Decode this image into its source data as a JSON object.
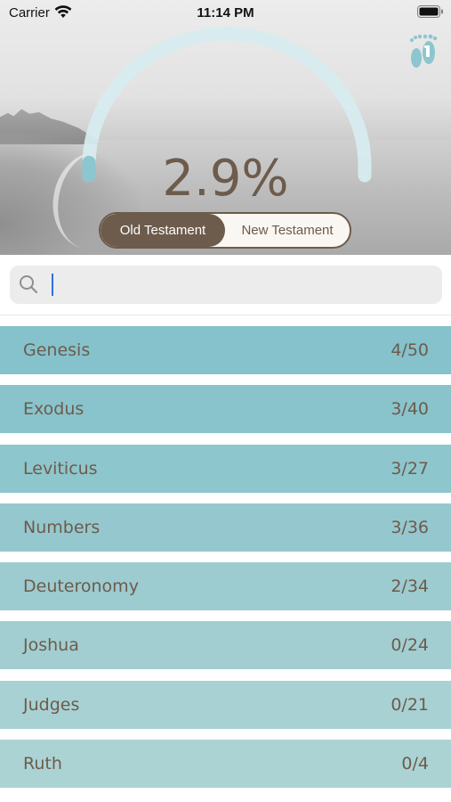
{
  "status_bar": {
    "carrier": "Carrier",
    "time": "11:14 PM"
  },
  "progress": {
    "percent_label": "2.9%",
    "value": 0.029
  },
  "testament_tabs": [
    {
      "label": "Old Testament",
      "active": true
    },
    {
      "label": "New Testament",
      "active": false
    }
  ],
  "search": {
    "value": "",
    "placeholder": ""
  },
  "books": [
    {
      "name": "Genesis",
      "progress": "4/50",
      "color": "#85c2cb"
    },
    {
      "name": "Exodus",
      "progress": "3/40",
      "color": "#89c4cc"
    },
    {
      "name": "Leviticus",
      "progress": "3/27",
      "color": "#8ec6cd"
    },
    {
      "name": "Numbers",
      "progress": "3/36",
      "color": "#95c8ce"
    },
    {
      "name": "Deuteronomy",
      "progress": "2/34",
      "color": "#9ccbd0"
    },
    {
      "name": "Joshua",
      "progress": "0/24",
      "color": "#a2ced2"
    },
    {
      "name": "Judges",
      "progress": "0/21",
      "color": "#a8d1d3"
    },
    {
      "name": "Ruth",
      "progress": "0/4",
      "color": "#acd3d4"
    }
  ],
  "colors": {
    "brown": "#6d5b4c",
    "arc_track": "#d7ecf0",
    "arc_fill": "#8cc6cf",
    "caret": "#2f6fe4"
  },
  "icons": {
    "wifi": "wifi-icon",
    "battery": "battery-icon",
    "search": "search-icon",
    "feet": "footprints-icon"
  }
}
